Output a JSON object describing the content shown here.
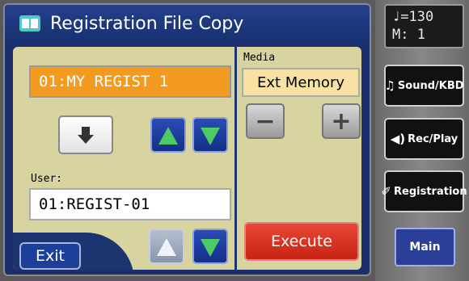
{
  "window": {
    "title": "Registration File Copy"
  },
  "source": {
    "value": "01:MY REGIST 1"
  },
  "user": {
    "label": "User:",
    "value": "01:REGIST-01"
  },
  "media": {
    "label": "Media",
    "value": "Ext Memory",
    "minus": "−",
    "plus": "+"
  },
  "buttons": {
    "execute": "Execute",
    "exit": "Exit"
  },
  "tempo": {
    "bpm_line": "♩=130",
    "measure_line": "M:   1"
  },
  "side": {
    "sound": {
      "icon": "♫",
      "label": "Sound/KBD"
    },
    "recplay": {
      "icon": "◀)",
      "label": "Rec/Play"
    },
    "registration": {
      "icon": "✐",
      "label": "Registration"
    },
    "main": "Main"
  },
  "colors": {
    "accent_orange": "#f39b20",
    "execute_red": "#d9301f",
    "arrow_green": "#4ecb64",
    "panel_blue": "#1c2f6c"
  }
}
